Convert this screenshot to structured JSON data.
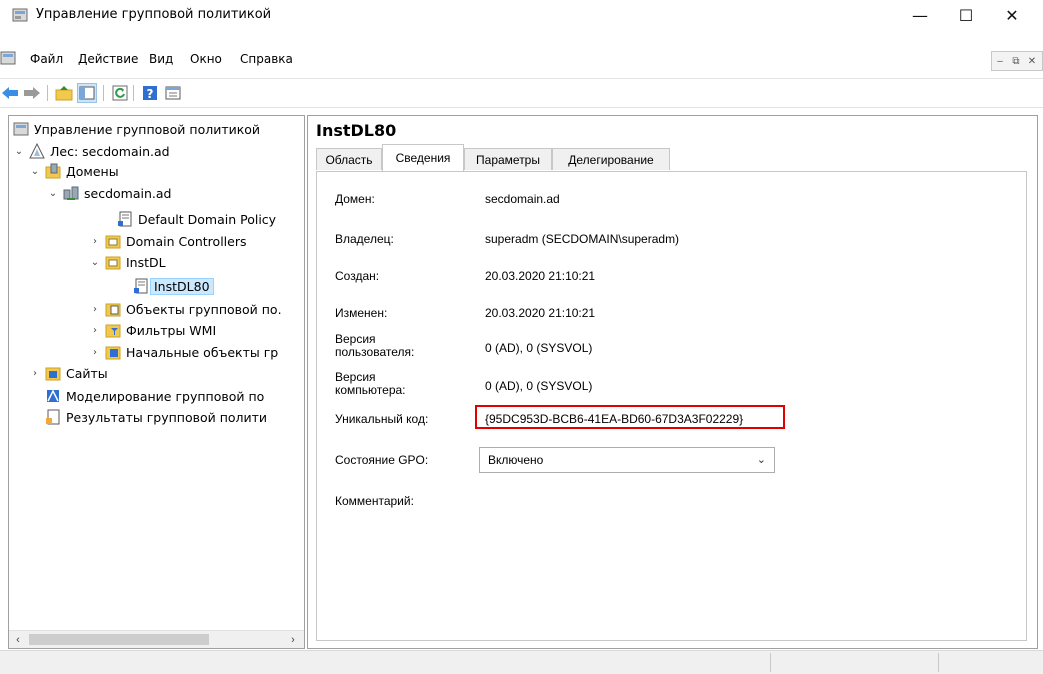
{
  "window": {
    "title": "Управление групповой политикой",
    "controls": {
      "minimize": "—",
      "maximize": "☐",
      "close": "✕"
    }
  },
  "menu": [
    "Файл",
    "Действие",
    "Вид",
    "Окно",
    "Справка"
  ],
  "toolbar": {
    "buttons": [
      "back-arrow-icon",
      "forward-arrow-icon",
      "up-folder-icon",
      "show-hide-tree-icon",
      "refresh-icon",
      "help-icon",
      "properties-icon"
    ]
  },
  "tree": {
    "root": "Управление групповой политикой",
    "forest": "Лес: secdomain.ad",
    "domains": "Домены",
    "domain": "secdomain.ad",
    "default_policy": "Default Domain Policy",
    "domain_controllers": "Domain Controllers",
    "ou": "InstDL",
    "selected_gpo": "InstDL80",
    "gpo_objects": "Объекты групповой по.",
    "wmi_filters": "Фильтры WMI",
    "starter_gpos": "Начальные объекты гр",
    "sites": "Сайты",
    "modeling": "Моделирование групповой по",
    "results": "Результаты групповой полити"
  },
  "details": {
    "title": "InstDL80",
    "tabs": [
      "Область",
      "Сведения",
      "Параметры",
      "Делегирование"
    ],
    "active_tab": "Сведения",
    "fields": {
      "domain_label": "Домен:",
      "domain_value": "secdomain.ad",
      "owner_label": "Владелец:",
      "owner_value": "superadm (SECDOMAIN\\superadm)",
      "created_label": "Создан:",
      "created_value": "20.03.2020 21:10:21",
      "modified_label": "Изменен:",
      "modified_value": "20.03.2020 21:10:21",
      "user_version_label_1": "Версия",
      "user_version_label_2": "пользователя:",
      "user_version_value": "0 (AD), 0 (SYSVOL)",
      "computer_version_label_1": "Версия",
      "computer_version_label_2": "компьютера:",
      "computer_version_value": "0 (AD), 0 (SYSVOL)",
      "unique_id_label": "Уникальный код:",
      "unique_id_value": "{95DC953D-BCB6-41EA-BD60-67D3A3F02229}",
      "gpo_status_label": "Состояние GPO:",
      "gpo_status_value": "Включено",
      "comment_label": "Комментарий:"
    }
  },
  "colors": {
    "highlight_box": "#e00000",
    "selection": "#cce8ff"
  }
}
